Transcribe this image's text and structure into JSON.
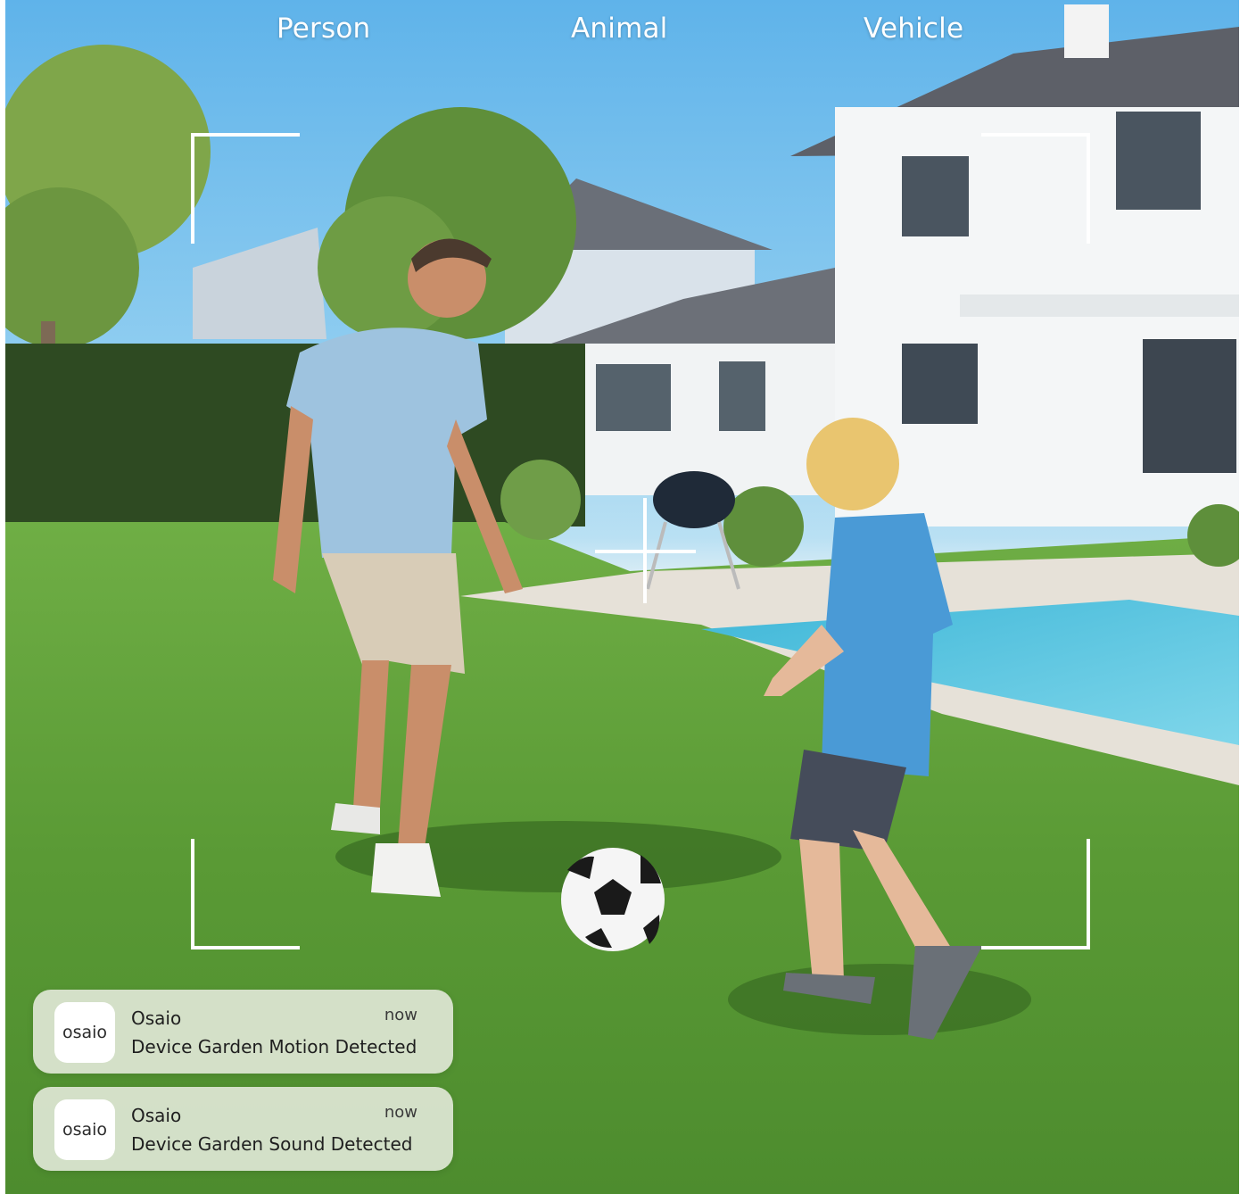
{
  "categories": {
    "person": "Person",
    "animal": "Animal",
    "vehicle": "Vehicle"
  },
  "notifications": [
    {
      "icon_text": "osaio",
      "app": "Osaio",
      "time": "now",
      "message": "Device Garden Motion Detected"
    },
    {
      "icon_text": "osaio",
      "app": "Osaio",
      "time": "now",
      "message": "Device Garden Sound Detected"
    }
  ],
  "colors": {
    "overlay": "#ffffff",
    "notification_bg": "#dee6d4",
    "lawn": "#5f9a3a",
    "sky": "#5fb3ea"
  }
}
